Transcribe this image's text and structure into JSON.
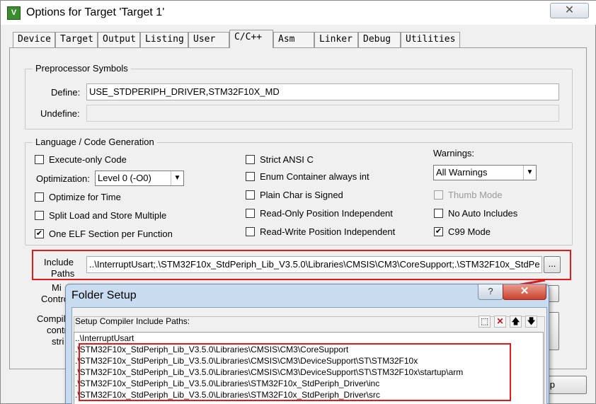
{
  "window": {
    "title": "Options for Target 'Target 1'",
    "app_icon_glyph": "V",
    "close_glyph": "✕"
  },
  "tabs": [
    {
      "label": "Device",
      "active": false
    },
    {
      "label": "Target",
      "active": false
    },
    {
      "label": "Output",
      "active": false
    },
    {
      "label": "Listing",
      "active": false
    },
    {
      "label": "User",
      "active": false
    },
    {
      "label": "C/C++",
      "active": true
    },
    {
      "label": "Asm",
      "active": false
    },
    {
      "label": "Linker",
      "active": false
    },
    {
      "label": "Debug",
      "active": false
    },
    {
      "label": "Utilities",
      "active": false
    }
  ],
  "preprocessor": {
    "title": "Preprocessor Symbols",
    "define_label": "Define:",
    "define_value": "USE_STDPERIPH_DRIVER,STM32F10X_MD",
    "undefine_label": "Undefine:",
    "undefine_value": ""
  },
  "language": {
    "title": "Language / Code Generation",
    "execute_only": {
      "label": "Execute-only Code",
      "checked": false
    },
    "optimization_label": "Optimization:",
    "optimization_value": "Level 0 (-O0)",
    "optimize_time": {
      "label": "Optimize for Time",
      "checked": false
    },
    "split_load": {
      "label": "Split Load and Store Multiple",
      "checked": false
    },
    "one_elf": {
      "label": "One ELF Section per Function",
      "checked": true
    },
    "strict_ansi": {
      "label": "Strict ANSI C",
      "checked": false
    },
    "enum_container": {
      "label": "Enum Container always int",
      "checked": false
    },
    "plain_char": {
      "label": "Plain Char is Signed",
      "checked": false
    },
    "ro_position": {
      "label": "Read-Only Position Independent",
      "checked": false
    },
    "rw_position": {
      "label": "Read-Write Position Independent",
      "checked": false
    },
    "warnings_label": "Warnings:",
    "warnings_value": "All Warnings",
    "thumb_mode": {
      "label": "Thumb Mode",
      "checked": false,
      "disabled": true
    },
    "no_auto_includes": {
      "label": "No Auto Includes",
      "checked": false
    },
    "c99_mode": {
      "label": "C99 Mode",
      "checked": true
    }
  },
  "include_paths": {
    "label_line1": "Include",
    "label_line2": "Paths",
    "value": "..\\InterruptUsart;.\\STM32F10x_StdPeriph_Lib_V3.5.0\\Libraries\\CMSIS\\CM3\\CoreSupport;.\\STM32F10x_StdPe",
    "browse_label": "..."
  },
  "hidden_labels": {
    "misc_partial": "Mi",
    "controls_partial": "Contro",
    "compiler_partial": "Compil",
    "control_partial": "contr",
    "string_partial": "stri",
    "help_button_partial": "p"
  },
  "check_glyph": "✔",
  "dropdown_glyph": "▼",
  "folder_setup": {
    "title": "Folder Setup",
    "help_glyph": "?",
    "close_glyph": "✕",
    "heading": "Setup Compiler Include Paths:",
    "toolbar": {
      "new_glyph": "⬚",
      "delete_glyph": "✕",
      "up_glyph": "🡅",
      "down_glyph": "🡇"
    },
    "paths": [
      "..\\InterruptUsart",
      ".\\STM32F10x_StdPeriph_Lib_V3.5.0\\Libraries\\CMSIS\\CM3\\CoreSupport",
      ".\\STM32F10x_StdPeriph_Lib_V3.5.0\\Libraries\\CMSIS\\CM3\\DeviceSupport\\ST\\STM32F10x",
      ".\\STM32F10x_StdPeriph_Lib_V3.5.0\\Libraries\\CMSIS\\CM3\\DeviceSupport\\ST\\STM32F10x\\startup\\arm",
      ".\\STM32F10x_StdPeriph_Lib_V3.5.0\\Libraries\\STM32F10x_StdPeriph_Driver\\inc",
      ".\\STM32F10x_StdPeriph_Lib_V3.5.0\\Libraries\\STM32F10x_StdPeriph_Driver\\src"
    ]
  },
  "colors": {
    "highlight_red": "#e2191b",
    "dialog_frame": "#c9dcef"
  }
}
